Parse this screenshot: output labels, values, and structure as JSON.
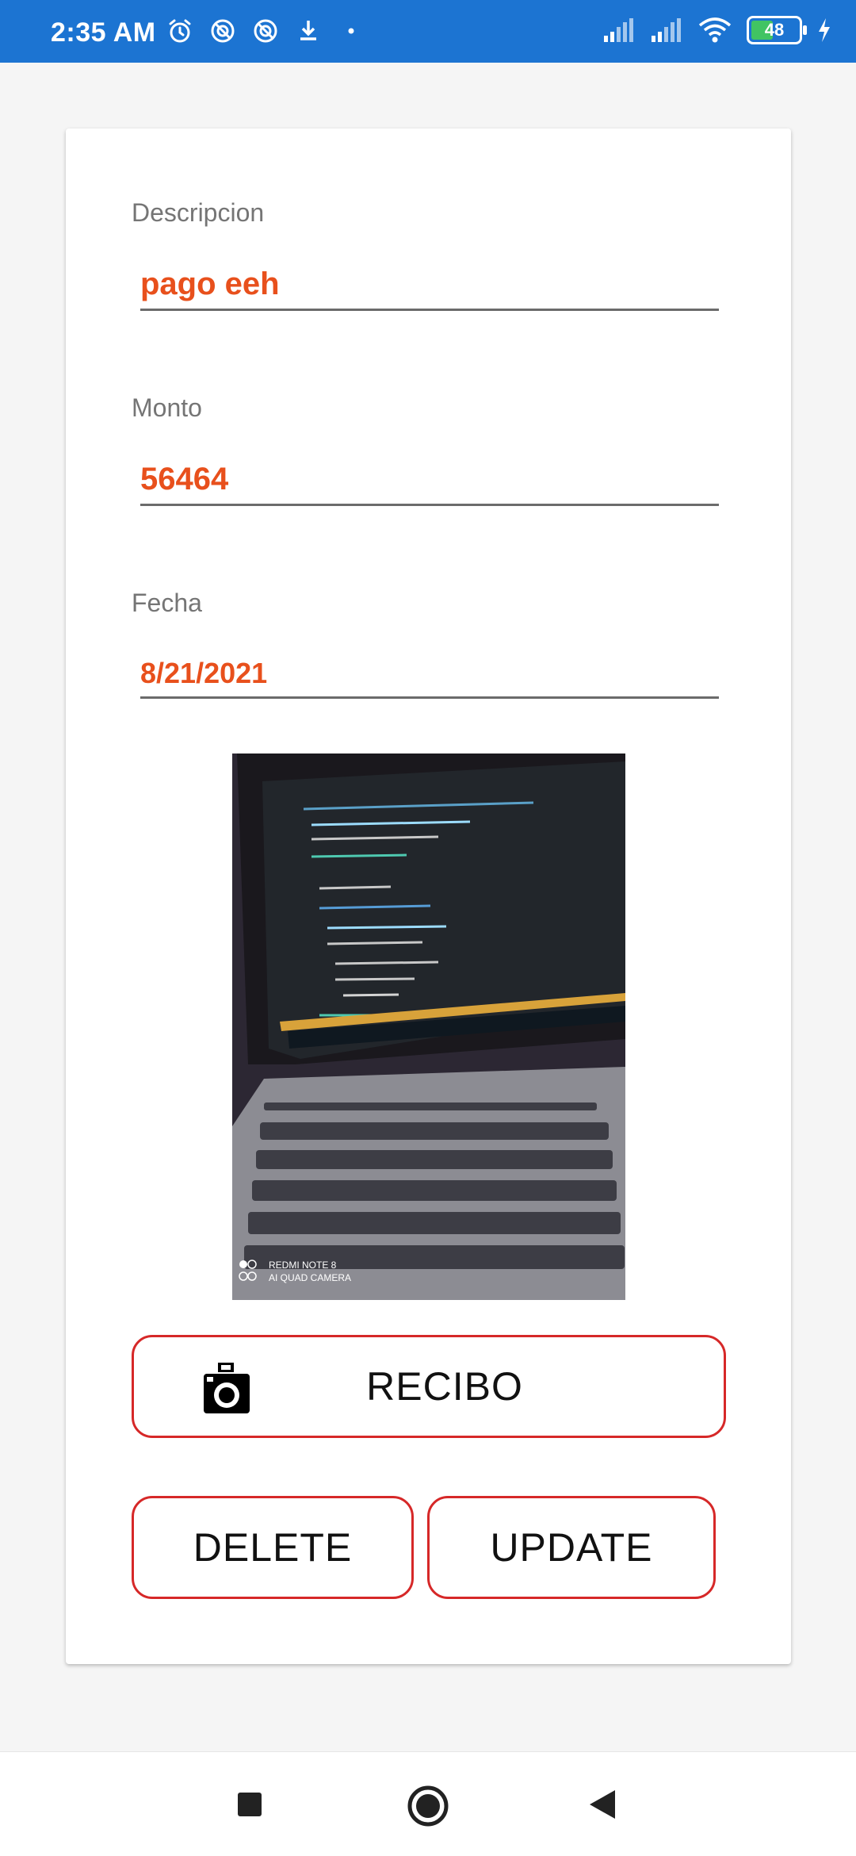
{
  "status_bar": {
    "time": "2:35 AM",
    "battery_level": "48",
    "color": "#1c74d2"
  },
  "form": {
    "descripcion": {
      "label": "Descripcion",
      "value": "pago eeh"
    },
    "monto": {
      "label": "Monto",
      "value": "56464"
    },
    "fecha": {
      "label": "Fecha",
      "value": "8/21/2021"
    },
    "value_color": "#e8501c"
  },
  "photo": {
    "watermark_line1": "REDMI NOTE 8",
    "watermark_line2": "AI QUAD CAMERA"
  },
  "buttons": {
    "recibo": "RECIBO",
    "delete": "DELETE",
    "update": "UPDATE",
    "border_color": "#d62828"
  },
  "icons": {
    "camera": "camera-icon",
    "alarm": "alarm-icon",
    "download": "download-icon",
    "signal": "signal-icon",
    "wifi": "wifi-icon",
    "battery": "battery-icon",
    "charging": "charging-icon",
    "nav_recents": "recents-icon",
    "nav_home": "home-icon",
    "nav_back": "back-icon"
  }
}
